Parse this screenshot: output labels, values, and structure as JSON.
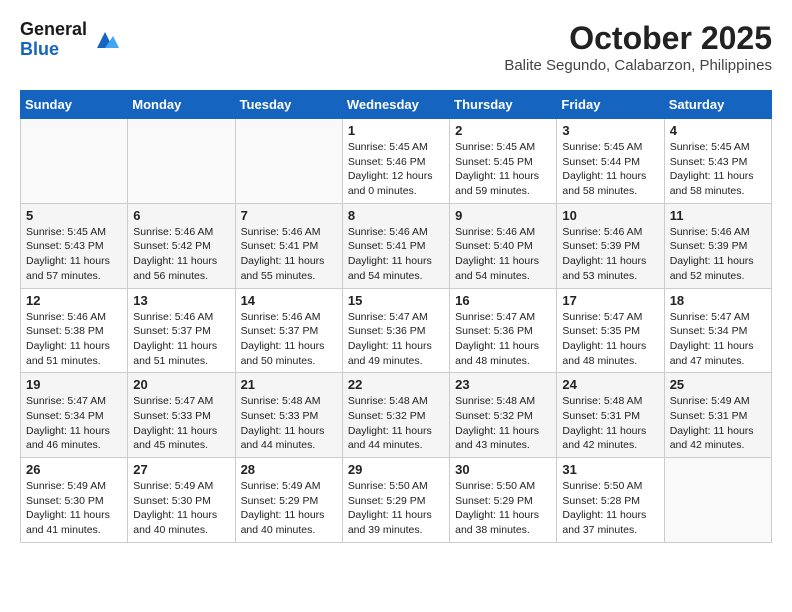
{
  "header": {
    "logo_line1": "General",
    "logo_line2": "Blue",
    "month_year": "October 2025",
    "location": "Balite Segundo, Calabarzon, Philippines"
  },
  "weekdays": [
    "Sunday",
    "Monday",
    "Tuesday",
    "Wednesday",
    "Thursday",
    "Friday",
    "Saturday"
  ],
  "weeks": [
    [
      {
        "day": "",
        "info": ""
      },
      {
        "day": "",
        "info": ""
      },
      {
        "day": "",
        "info": ""
      },
      {
        "day": "1",
        "info": "Sunrise: 5:45 AM\nSunset: 5:46 PM\nDaylight: 12 hours\nand 0 minutes."
      },
      {
        "day": "2",
        "info": "Sunrise: 5:45 AM\nSunset: 5:45 PM\nDaylight: 11 hours\nand 59 minutes."
      },
      {
        "day": "3",
        "info": "Sunrise: 5:45 AM\nSunset: 5:44 PM\nDaylight: 11 hours\nand 58 minutes."
      },
      {
        "day": "4",
        "info": "Sunrise: 5:45 AM\nSunset: 5:43 PM\nDaylight: 11 hours\nand 58 minutes."
      }
    ],
    [
      {
        "day": "5",
        "info": "Sunrise: 5:45 AM\nSunset: 5:43 PM\nDaylight: 11 hours\nand 57 minutes."
      },
      {
        "day": "6",
        "info": "Sunrise: 5:46 AM\nSunset: 5:42 PM\nDaylight: 11 hours\nand 56 minutes."
      },
      {
        "day": "7",
        "info": "Sunrise: 5:46 AM\nSunset: 5:41 PM\nDaylight: 11 hours\nand 55 minutes."
      },
      {
        "day": "8",
        "info": "Sunrise: 5:46 AM\nSunset: 5:41 PM\nDaylight: 11 hours\nand 54 minutes."
      },
      {
        "day": "9",
        "info": "Sunrise: 5:46 AM\nSunset: 5:40 PM\nDaylight: 11 hours\nand 54 minutes."
      },
      {
        "day": "10",
        "info": "Sunrise: 5:46 AM\nSunset: 5:39 PM\nDaylight: 11 hours\nand 53 minutes."
      },
      {
        "day": "11",
        "info": "Sunrise: 5:46 AM\nSunset: 5:39 PM\nDaylight: 11 hours\nand 52 minutes."
      }
    ],
    [
      {
        "day": "12",
        "info": "Sunrise: 5:46 AM\nSunset: 5:38 PM\nDaylight: 11 hours\nand 51 minutes."
      },
      {
        "day": "13",
        "info": "Sunrise: 5:46 AM\nSunset: 5:37 PM\nDaylight: 11 hours\nand 51 minutes."
      },
      {
        "day": "14",
        "info": "Sunrise: 5:46 AM\nSunset: 5:37 PM\nDaylight: 11 hours\nand 50 minutes."
      },
      {
        "day": "15",
        "info": "Sunrise: 5:47 AM\nSunset: 5:36 PM\nDaylight: 11 hours\nand 49 minutes."
      },
      {
        "day": "16",
        "info": "Sunrise: 5:47 AM\nSunset: 5:36 PM\nDaylight: 11 hours\nand 48 minutes."
      },
      {
        "day": "17",
        "info": "Sunrise: 5:47 AM\nSunset: 5:35 PM\nDaylight: 11 hours\nand 48 minutes."
      },
      {
        "day": "18",
        "info": "Sunrise: 5:47 AM\nSunset: 5:34 PM\nDaylight: 11 hours\nand 47 minutes."
      }
    ],
    [
      {
        "day": "19",
        "info": "Sunrise: 5:47 AM\nSunset: 5:34 PM\nDaylight: 11 hours\nand 46 minutes."
      },
      {
        "day": "20",
        "info": "Sunrise: 5:47 AM\nSunset: 5:33 PM\nDaylight: 11 hours\nand 45 minutes."
      },
      {
        "day": "21",
        "info": "Sunrise: 5:48 AM\nSunset: 5:33 PM\nDaylight: 11 hours\nand 44 minutes."
      },
      {
        "day": "22",
        "info": "Sunrise: 5:48 AM\nSunset: 5:32 PM\nDaylight: 11 hours\nand 44 minutes."
      },
      {
        "day": "23",
        "info": "Sunrise: 5:48 AM\nSunset: 5:32 PM\nDaylight: 11 hours\nand 43 minutes."
      },
      {
        "day": "24",
        "info": "Sunrise: 5:48 AM\nSunset: 5:31 PM\nDaylight: 11 hours\nand 42 minutes."
      },
      {
        "day": "25",
        "info": "Sunrise: 5:49 AM\nSunset: 5:31 PM\nDaylight: 11 hours\nand 42 minutes."
      }
    ],
    [
      {
        "day": "26",
        "info": "Sunrise: 5:49 AM\nSunset: 5:30 PM\nDaylight: 11 hours\nand 41 minutes."
      },
      {
        "day": "27",
        "info": "Sunrise: 5:49 AM\nSunset: 5:30 PM\nDaylight: 11 hours\nand 40 minutes."
      },
      {
        "day": "28",
        "info": "Sunrise: 5:49 AM\nSunset: 5:29 PM\nDaylight: 11 hours\nand 40 minutes."
      },
      {
        "day": "29",
        "info": "Sunrise: 5:50 AM\nSunset: 5:29 PM\nDaylight: 11 hours\nand 39 minutes."
      },
      {
        "day": "30",
        "info": "Sunrise: 5:50 AM\nSunset: 5:29 PM\nDaylight: 11 hours\nand 38 minutes."
      },
      {
        "day": "31",
        "info": "Sunrise: 5:50 AM\nSunset: 5:28 PM\nDaylight: 11 hours\nand 37 minutes."
      },
      {
        "day": "",
        "info": ""
      }
    ]
  ]
}
